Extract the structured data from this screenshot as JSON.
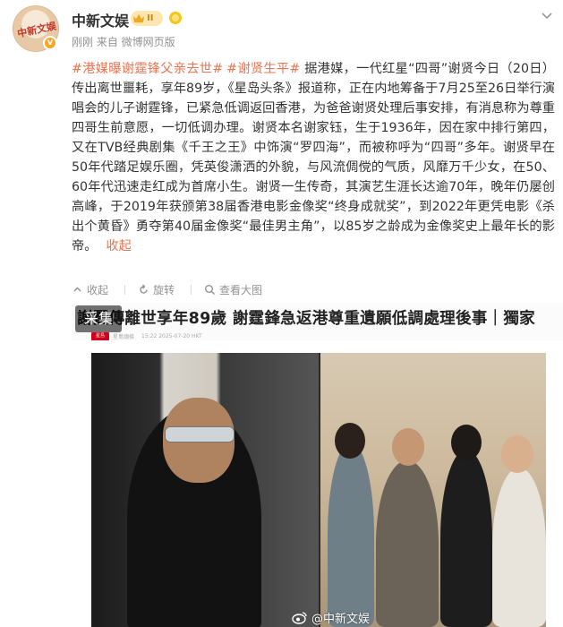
{
  "post": {
    "author": "中新文娱",
    "vip_level": "II",
    "meta": "刚刚 来自 微博网页版",
    "avatar_text": "中新文娱",
    "topic_1": "#港媒曝谢霆锋父亲去世#",
    "topic_2": "#谢贤生平#",
    "body": "据港媒，一代红星“四哥”谢贤今日（20日）传出离世噩耗，享年89岁，《星岛头条》报道称，正在内地筹备于7月25至26日举行演唱会的儿子谢霆锋，已紧急低调返回香港，为爸爸谢贤处理后事安排，有消息称为尊重四哥生前意愿，一切低调办理。谢贤本名谢家钰，生于1936年，因在家中排行第四，又在TVB经典剧集《千王之王》中饰演“罗四海”，而被称呼为“四哥”多年。谢贤早在50年代踏足娱乐圈，凭英俊潇洒的外貌，与风流倜傥的气质，风靡万千少女，在50、60年代迅速走红成为首席小生。谢贤一生传奇，其演艺生涯长达逾70年，晚年仍屡创高峰，于2019年获颁第38届香港电影金像奖“终身成就奖”，到2022年更凭电影《杀出个黄昏》勇夺第40届金像奖“最佳男主角”，以85岁之龄成为金像奖史上最年长的影帝。",
    "collapse_label": "收起"
  },
  "toolbar": {
    "collect_label": "收起",
    "rotate_label": "旋转",
    "view_large_label": "查看大图"
  },
  "media": {
    "headline": "謝賢傳離世享年89歲 謝霆鋒急返港尊重遺願低調處理後事｜獨家",
    "collect_button": "采集",
    "source_logo": "星島",
    "source_name": "星島頭條",
    "timestamp": "15:22 2025-07-20 HKT",
    "watermark": "@中新文娱"
  },
  "colors": {
    "topic": "#eb7350",
    "meta_gray": "#939393"
  },
  "icons": [
    "more-icon",
    "vip-crown-icon",
    "medal-icon",
    "collapse-icon",
    "rotate-icon",
    "zoom-icon",
    "weibo-logo-icon"
  ]
}
